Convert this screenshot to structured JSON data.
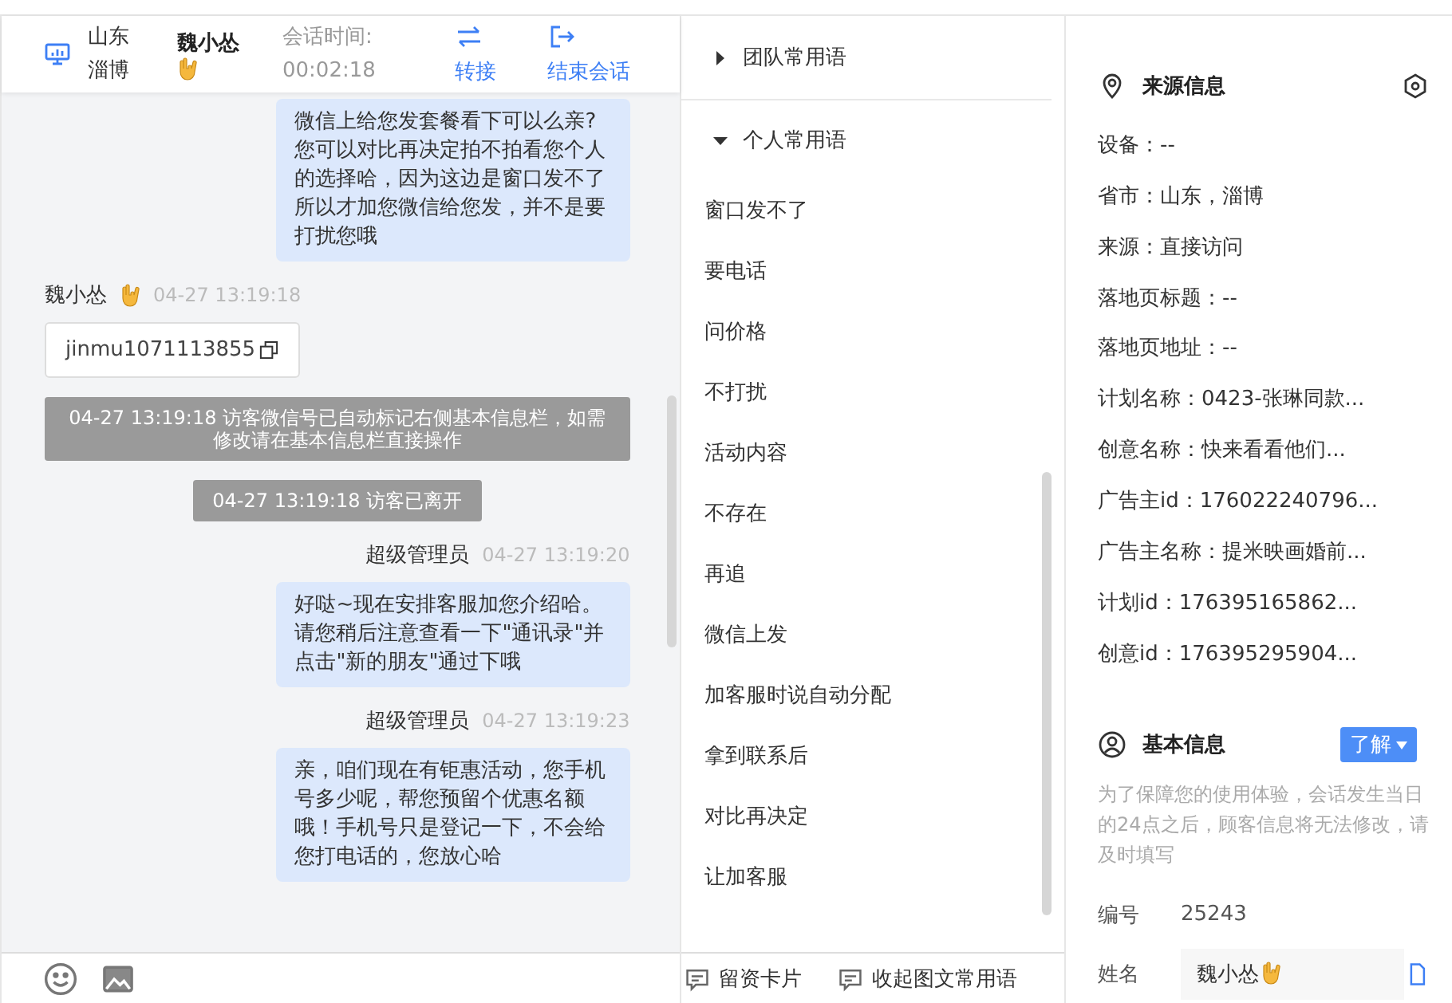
{
  "header": {
    "location": "山东淄博",
    "visitor": "魏小怂",
    "timer_label": "会话时间:",
    "timer": "00:02:18",
    "actions": [
      {
        "kind": "transfer",
        "label": "转接"
      },
      {
        "kind": "end",
        "label": "结束会话"
      }
    ]
  },
  "messages": [
    {
      "kind": "agent",
      "text": "微信上给您发套餐看下可以么亲?您可以对比再决定拍不拍看您个人的选择哈，因为这边是窗口发不了所以才加您微信给您发，并不是要打扰您哦"
    },
    {
      "kind": "visitor",
      "sender": "魏小怂",
      "time": "04-27 13:19:18",
      "text": "jinmu1071113855"
    },
    {
      "kind": "system",
      "text": "04-27 13:19:18 访客微信号已自动标记右侧基本信息栏，如需修改请在基本信息栏直接操作"
    },
    {
      "kind": "system",
      "text": "04-27 13:19:18 访客已离开"
    },
    {
      "kind": "agent",
      "sender": "超级管理员",
      "time": "04-27 13:19:20",
      "text": "好哒~现在安排客服加您介绍哈。请您稍后注意查看一下\"通讯录\"并点击\"新的朋友\"通过下哦"
    },
    {
      "kind": "agent",
      "sender": "超级管理员",
      "time": "04-27 13:19:23",
      "text": "亲，咱们现在有钜惠活动，您手机号多少呢，帮您预留个优惠名额哦！手机号只是登记一下，不会给您打电话的，您放心哈"
    }
  ],
  "phrases": [
    {
      "title": "团队常用语",
      "expanded": false
    },
    {
      "title": "个人常用语",
      "expanded": true,
      "items": [
        "窗口发不了",
        "要电话",
        "问价格",
        "不打扰",
        "活动内容",
        "不存在",
        "再追",
        "微信上发",
        "加客服时说自动分配",
        "拿到联系后",
        "对比再决定",
        "让加客服"
      ]
    }
  ],
  "phrase_actions": [
    "留资卡片",
    "收起图文常用语"
  ],
  "source": {
    "title": "来源信息",
    "fields": [
      "设备：--",
      "省市：山东，淄博",
      "来源：直接访问",
      "落地页标题：--",
      "落地页地址：--",
      "计划名称：0423-张琳同款...",
      "创意名称：快来看看他们...",
      "广告主id：176022240796...",
      "广告主名称：提米映画婚前...",
      "计划id：176395165862...",
      "创意id：176395295904..."
    ]
  },
  "basic": {
    "title": "基本信息",
    "button": "了解",
    "note": "为了保障您的使用体验，会话发生当日的24点之后，顾客信息将无法修改，请及时填写",
    "fields": [
      {
        "kind": "text",
        "label": "编号",
        "value": "25243"
      },
      {
        "kind": "input",
        "label": "姓名",
        "value": "魏小怂"
      }
    ]
  }
}
